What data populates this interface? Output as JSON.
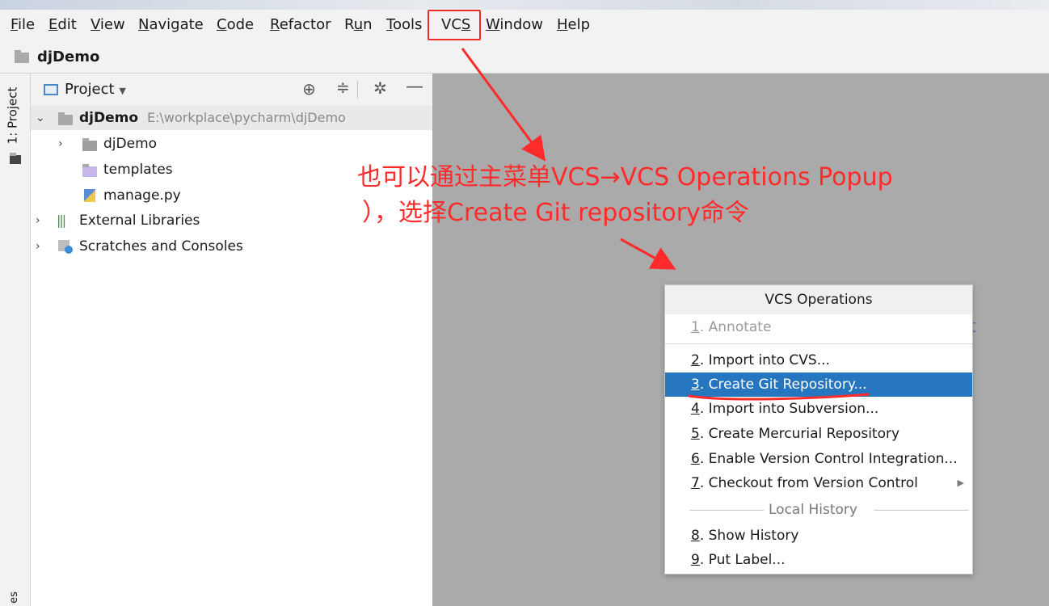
{
  "menubar": {
    "items": [
      {
        "label": "File",
        "mnemonic": "F",
        "rest": "ile"
      },
      {
        "label": "Edit",
        "mnemonic": "E",
        "rest": "dit"
      },
      {
        "label": "View",
        "mnemonic": "V",
        "rest": "iew"
      },
      {
        "label": "Navigate",
        "mnemonic": "N",
        "rest": "avigate"
      },
      {
        "label": "Code",
        "mnemonic": "C",
        "rest": "ode"
      },
      {
        "label": "Refactor",
        "mnemonic": "R",
        "rest": "efactor"
      },
      {
        "label": "Run",
        "pre": "R",
        "mnemonic": "u",
        "rest": "n"
      },
      {
        "label": "Tools",
        "mnemonic": "T",
        "rest": "ools"
      },
      {
        "label": "VCS",
        "pre": "VC",
        "mnemonic": "S",
        "rest": ""
      },
      {
        "label": "Window",
        "mnemonic": "W",
        "rest": "indow"
      },
      {
        "label": "Help",
        "mnemonic": "H",
        "rest": "elp"
      }
    ]
  },
  "navbar": {
    "project_name": "djDemo"
  },
  "left_strip": {
    "project_tab": "1: Project",
    "bottom_tab": "es"
  },
  "project_panel": {
    "title": "Project",
    "tree": {
      "root": {
        "name": "djDemo",
        "path": "E:\\workplace\\pycharm\\djDemo"
      },
      "items": [
        {
          "name": "djDemo"
        },
        {
          "name": "templates"
        },
        {
          "name": "manage.py"
        },
        {
          "name": "External Libraries"
        },
        {
          "name": "Scratches and Consoles"
        }
      ]
    }
  },
  "annotation": {
    "line1": "也可以通过主菜单VCS→VCS Operations Popup",
    "line2": "），选择Create Git repository命令",
    "color": "#ff2a2a"
  },
  "popup": {
    "title": "VCS Operations",
    "items": [
      {
        "num": "1",
        "label": ". Annotate",
        "disabled": true
      },
      {
        "num": "2",
        "label": ". Import into CVS..."
      },
      {
        "num": "3",
        "label": ". Create Git Repository...",
        "highlighted": true
      },
      {
        "num": "4",
        "label": ". Import into Subversion..."
      },
      {
        "num": "5",
        "label": ". Create Mercurial Repository"
      },
      {
        "num": "6",
        "label": ". Enable Version Control Integration..."
      },
      {
        "num": "7",
        "label": ". Checkout from Version Control",
        "submenu": true
      },
      {
        "num": "8",
        "label": ". Show History"
      },
      {
        "num": "9",
        "label": ". Put Label..."
      }
    ],
    "group_label": "Local History",
    "highlight_color": "#2675bf"
  },
  "editor": {
    "clipped_text": "t"
  }
}
